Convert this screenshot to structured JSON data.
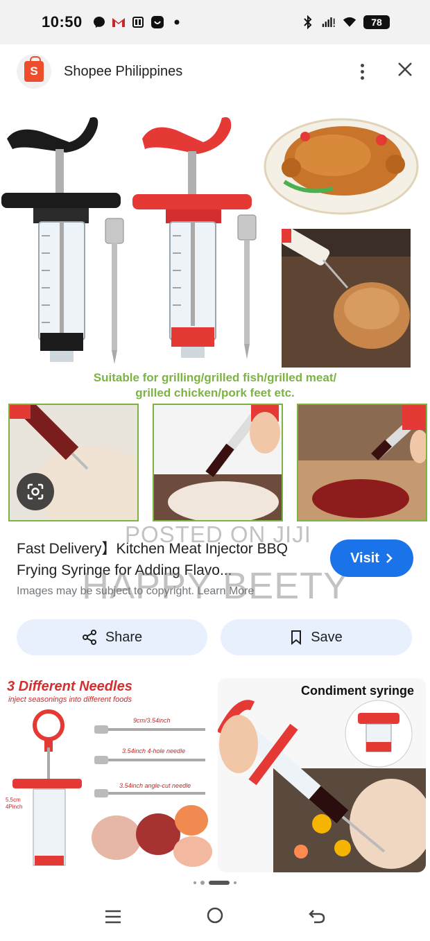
{
  "status_bar": {
    "time": "10:50",
    "battery": "78",
    "left_icons": [
      "messenger-icon",
      "gmail-icon",
      "app-icon",
      "camera-app-icon",
      "dot-icon"
    ],
    "right_icons": [
      "bluetooth-icon",
      "signal-icon",
      "wifi-icon"
    ]
  },
  "header": {
    "site_name": "Shopee Philippines",
    "logo_letter": "S"
  },
  "image": {
    "caption_line1": "Suitable for grilling/grilled fish/grilled meat/",
    "caption_line2": "grilled chicken/pork feet etc.",
    "syringe_labels_black": [
      "30ml",
      "1oz",
      "25ml",
      "20ml",
      "3/4oz",
      "15ml",
      "1/2oz",
      "10ml",
      "1/4oz",
      "5ml"
    ],
    "syringe_labels_red": [
      "30ml",
      "1oz",
      "25ml",
      "20ml",
      "3/4oz",
      "15ml",
      "1/2oz",
      "10ml",
      "1/4oz"
    ]
  },
  "result": {
    "title": "Fast Delivery】Kitchen Meat Injector BBQ Frying Syringe for Adding Flavo...",
    "copyright": "Images may be subject to copyright. Learn More",
    "visit_label": "Visit"
  },
  "watermark": {
    "line1": "POSTED ON JIJI",
    "line2": "HAPPY BEETY"
  },
  "actions": {
    "share_label": "Share",
    "save_label": "Save"
  },
  "related": {
    "left_title": "3 Different Needles",
    "left_subtitle": "inject seasonings into different foods",
    "left_needle1": "9cm/3.54inch",
    "left_needle2": "3.54inch 4-hole needle",
    "left_needle3": "3.54inch angle-cut needle",
    "left_side_label1": "5.5cm",
    "left_side_label2": "4Pinch",
    "right_title": "Condiment syringe"
  },
  "colors": {
    "accent": "#1a73e8",
    "brand": "#ee4d2d",
    "caption_green": "#7cb342",
    "syringe_red": "#e53935"
  }
}
